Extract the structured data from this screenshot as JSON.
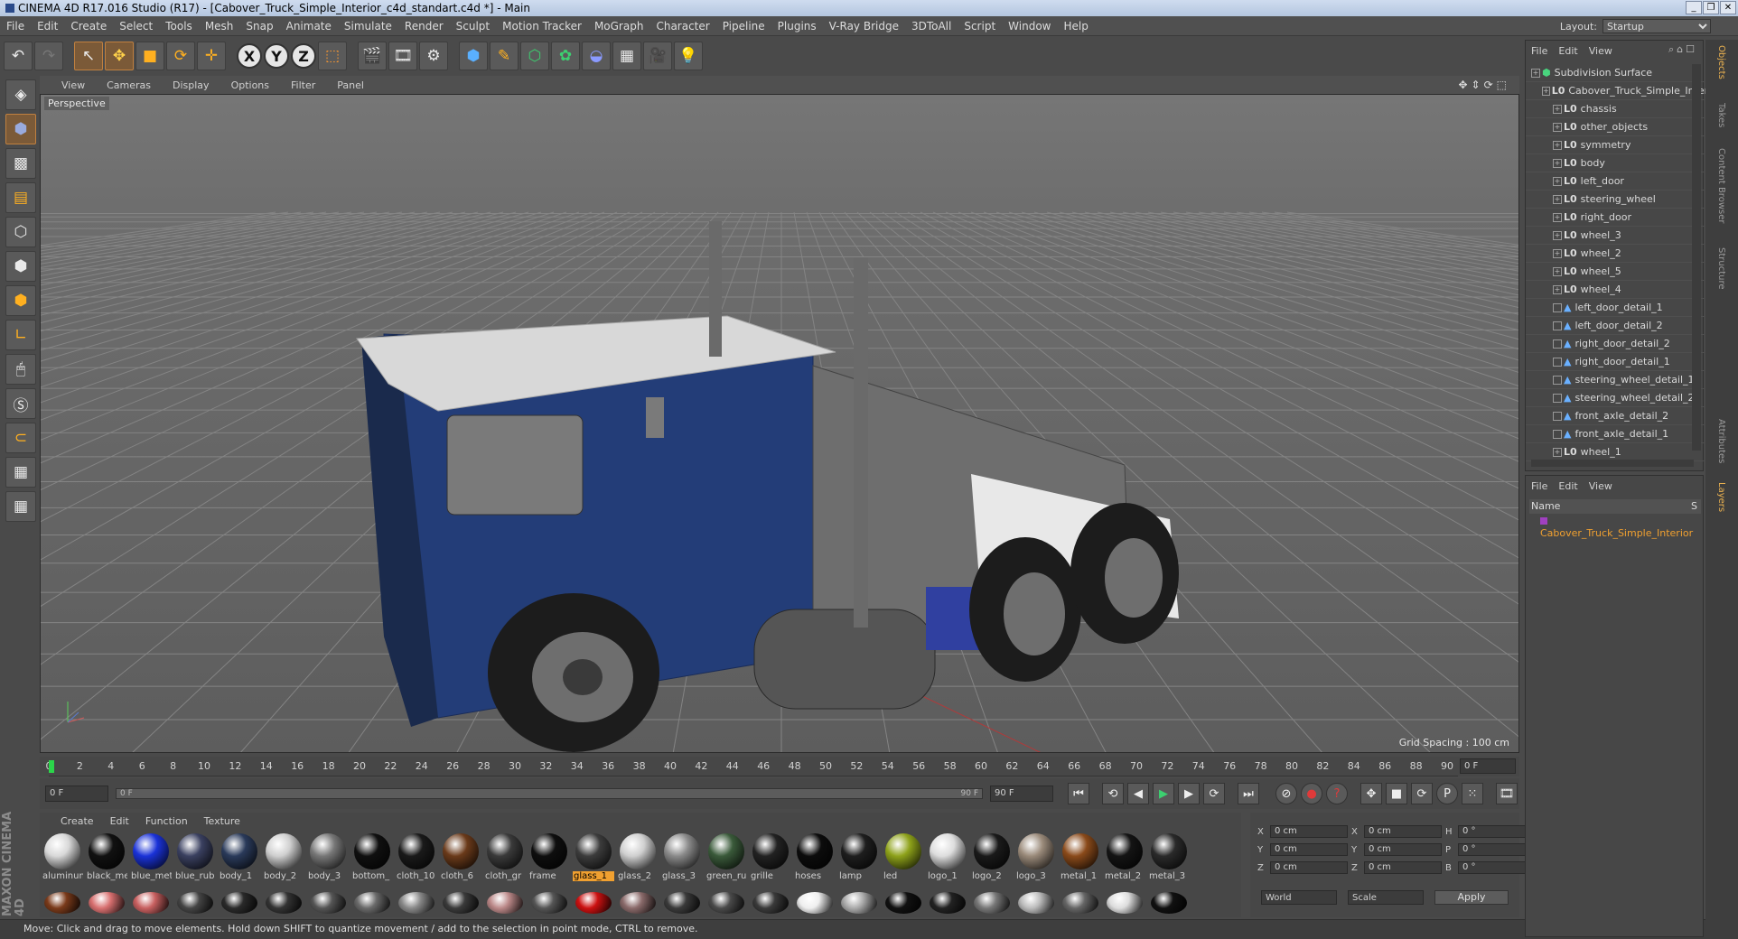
{
  "app": {
    "title": "CINEMA 4D R17.016 Studio (R17) - [Cabover_Truck_Simple_Interior_c4d_standart.c4d *] - Main"
  },
  "menu": [
    "File",
    "Edit",
    "Create",
    "Select",
    "Tools",
    "Mesh",
    "Snap",
    "Animate",
    "Simulate",
    "Render",
    "Sculpt",
    "Motion Tracker",
    "MoGraph",
    "Character",
    "Pipeline",
    "Plugins",
    "V-Ray Bridge",
    "3DToAll",
    "Script",
    "Window",
    "Help"
  ],
  "layout": {
    "label": "Layout:",
    "value": "Startup"
  },
  "viewport": {
    "menu": [
      "View",
      "Cameras",
      "Display",
      "Options",
      "Filter",
      "Panel"
    ],
    "label": "Perspective",
    "grid_spacing": "Grid Spacing : 100 cm"
  },
  "timeline": {
    "ticks": [
      "0",
      "2",
      "4",
      "6",
      "8",
      "10",
      "12",
      "14",
      "16",
      "18",
      "20",
      "22",
      "24",
      "26",
      "28",
      "30",
      "32",
      "34",
      "36",
      "38",
      "40",
      "42",
      "44",
      "46",
      "48",
      "50",
      "52",
      "54",
      "56",
      "58",
      "60",
      "62",
      "64",
      "66",
      "68",
      "70",
      "72",
      "74",
      "76",
      "78",
      "80",
      "82",
      "84",
      "86",
      "88",
      "90"
    ],
    "current_frame": "0 F"
  },
  "transport": {
    "start": "0 F",
    "slider_start": "0 F",
    "slider_end": "90 F",
    "end": "90 F"
  },
  "materials": {
    "menu": [
      "Create",
      "Edit",
      "Function",
      "Texture"
    ],
    "row1": [
      {
        "name": "aluminum",
        "color": "#d8d8d8"
      },
      {
        "name": "black_me",
        "color": "#111111"
      },
      {
        "name": "blue_met",
        "color": "#1a32d8"
      },
      {
        "name": "blue_rub",
        "color": "#3a4060"
      },
      {
        "name": "body_1",
        "color": "#2a3a5a"
      },
      {
        "name": "body_2",
        "color": "#cfcfcf"
      },
      {
        "name": "body_3",
        "color": "#777777"
      },
      {
        "name": "bottom_",
        "color": "#101010"
      },
      {
        "name": "cloth_10",
        "color": "#1a1a1a"
      },
      {
        "name": "cloth_6",
        "color": "#6a3a1a"
      },
      {
        "name": "cloth_gr",
        "color": "#3a3a3a"
      },
      {
        "name": "frame",
        "color": "#0e0e0e"
      },
      {
        "name": "glass_1",
        "color": "#3c3c3c",
        "selected": true
      },
      {
        "name": "glass_2",
        "color": "#cfcfcf"
      },
      {
        "name": "glass_3",
        "color": "#8a8a8a"
      },
      {
        "name": "green_ru",
        "color": "#3a5a3a"
      },
      {
        "name": "grille",
        "color": "#222222"
      },
      {
        "name": "hoses",
        "color": "#0c0c0c"
      },
      {
        "name": "lamp",
        "color": "#1e1e1e"
      },
      {
        "name": "led",
        "color": "#8ea21a"
      },
      {
        "name": "logo_1",
        "color": "#dddddd"
      },
      {
        "name": "logo_2",
        "color": "#1a1a1a"
      },
      {
        "name": "logo_3",
        "color": "#9a8a7a"
      },
      {
        "name": "metal_1",
        "color": "#8a4a1a"
      },
      {
        "name": "metal_2",
        "color": "#141414"
      },
      {
        "name": "metal_3",
        "color": "#2a2a2a"
      }
    ],
    "row2": [
      "#7a3a1a",
      "#d87070",
      "#c86060",
      "#444444",
      "#2a2a2a",
      "#333333",
      "#555555",
      "#6a6a6a",
      "#888888",
      "#3a3a3a",
      "#bb8888",
      "#555555",
      "#cc1111",
      "#8a6a6a",
      "#3a3a3a",
      "#4a4a4a",
      "#3a3a3a",
      "#eeeeee",
      "#aaaaaa",
      "#111111",
      "#222222",
      "#777777",
      "#bbbbbb",
      "#666666",
      "#dddddd",
      "#111111"
    ]
  },
  "coords": {
    "rows": [
      {
        "a": "X",
        "av": "0 cm",
        "b": "X",
        "bv": "0 cm",
        "c": "H",
        "cv": "0 °"
      },
      {
        "a": "Y",
        "av": "0 cm",
        "b": "Y",
        "bv": "0 cm",
        "c": "P",
        "cv": "0 °"
      },
      {
        "a": "Z",
        "av": "0 cm",
        "b": "Z",
        "bv": "0 cm",
        "c": "B",
        "cv": "0 °"
      }
    ],
    "world": "World",
    "scale": "Scale",
    "apply": "Apply"
  },
  "objects": {
    "menu": [
      "File",
      "Edit",
      "View"
    ],
    "items": [
      {
        "name": "Subdivision Surface",
        "type": "sub",
        "depth": 0
      },
      {
        "name": "Cabover_Truck_Simple_Interior",
        "type": "null",
        "depth": 1
      },
      {
        "name": "chassis",
        "type": "null",
        "depth": 2
      },
      {
        "name": "other_objects",
        "type": "null",
        "depth": 2
      },
      {
        "name": "symmetry",
        "type": "null",
        "depth": 2
      },
      {
        "name": "body",
        "type": "null",
        "depth": 2
      },
      {
        "name": "left_door",
        "type": "null",
        "depth": 2
      },
      {
        "name": "steering_wheel",
        "type": "null",
        "depth": 2
      },
      {
        "name": "right_door",
        "type": "null",
        "depth": 2
      },
      {
        "name": "wheel_3",
        "type": "null",
        "depth": 2
      },
      {
        "name": "wheel_2",
        "type": "null",
        "depth": 2
      },
      {
        "name": "wheel_5",
        "type": "null",
        "depth": 2
      },
      {
        "name": "wheel_4",
        "type": "null",
        "depth": 2
      },
      {
        "name": "left_door_detail_1",
        "type": "poly",
        "depth": 2
      },
      {
        "name": "left_door_detail_2",
        "type": "poly",
        "depth": 2
      },
      {
        "name": "right_door_detail_2",
        "type": "poly",
        "depth": 2
      },
      {
        "name": "right_door_detail_1",
        "type": "poly",
        "depth": 2
      },
      {
        "name": "steering_wheel_detail_1",
        "type": "poly",
        "depth": 2
      },
      {
        "name": "steering_wheel_detail_2",
        "type": "poly",
        "depth": 2
      },
      {
        "name": "front_axle_detail_2",
        "type": "poly",
        "depth": 2
      },
      {
        "name": "front_axle_detail_1",
        "type": "poly",
        "depth": 2
      },
      {
        "name": "wheel_1",
        "type": "null",
        "depth": 2
      }
    ]
  },
  "layers": {
    "menu": [
      "File",
      "Edit",
      "View"
    ],
    "header": "Name",
    "header_right": "S",
    "item": "Cabover_Truck_Simple_Interior"
  },
  "side_tabs": [
    "Objects",
    "Takes",
    "Content Browser",
    "Structure",
    "Attributes",
    "Layers"
  ],
  "branding": "MAXON CINEMA 4D",
  "status": "Move: Click and drag to move elements. Hold down SHIFT to quantize movement / add to the selection in point mode, CTRL to remove."
}
